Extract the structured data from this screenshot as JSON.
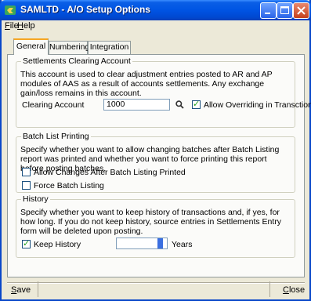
{
  "window": {
    "title": "SAMLTD - A/O Setup Options",
    "icon": "app-icon",
    "controls": [
      "minimize-icon",
      "maximize-icon",
      "close-icon"
    ]
  },
  "menu": {
    "file_first": "F",
    "file_rest": "ile",
    "help_first": "H",
    "help_rest": "elp"
  },
  "tabs": [
    {
      "label": "General",
      "active": true
    },
    {
      "label": "Numbering",
      "active": false
    },
    {
      "label": "Integration",
      "active": false
    }
  ],
  "settlements": {
    "title": "Settlements Clearing Account",
    "description": "This account is used to clear adjustment entries posted to AR and AP modules of AAS as a result of accounts settlements. Any exchange gain/loss remains in this account.",
    "clearing_label": "Clearing Account",
    "clearing_value": "1000",
    "allow_override_label": "Allow Overriding in Transctions",
    "allow_override_checked": true
  },
  "batch": {
    "title": "Batch List Printing",
    "description": "Specify whether you want to allow changing batches after Batch Listing report was printed and whether you want to force printing this report before posting batches.",
    "allow_changes_label": "Allow Changes After Batch Listing Printed",
    "allow_changes_checked": false,
    "force_label": "Force Batch Listing",
    "force_checked": false
  },
  "history": {
    "title": "History",
    "description": "Specify whether you want to keep history of transactions and, if yes, for how long. If you do not keep history, source entries in Settlements Entry form will be deleted upon posting.",
    "keep_label": "Keep History",
    "keep_checked": true,
    "years_value": "",
    "years_label": "Years"
  },
  "footer": {
    "save_first": "S",
    "save_rest": "ave",
    "close_first": "C",
    "close_rest": "lose"
  }
}
